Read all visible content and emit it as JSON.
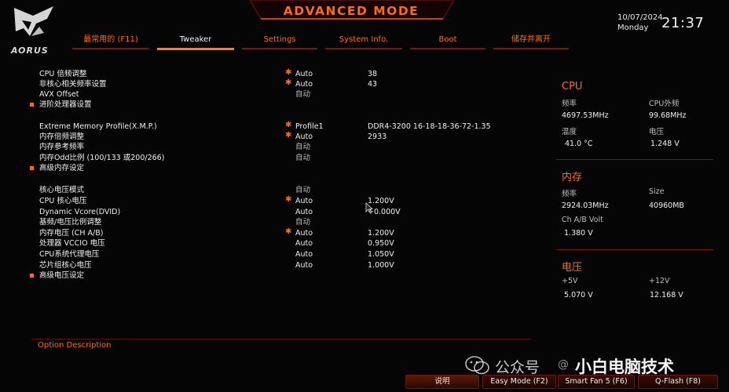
{
  "header": {
    "brand": "AORUS",
    "title": "ADVANCED MODE",
    "date": "10/07/2024",
    "day": "Monday",
    "time": "21:37"
  },
  "tabs": [
    {
      "label": "最常用的 (F11)",
      "active": false
    },
    {
      "label": "Tweaker",
      "active": true
    },
    {
      "label": "Settings",
      "active": false
    },
    {
      "label": "System Info.",
      "active": false
    },
    {
      "label": "Boot",
      "active": false
    },
    {
      "label": "储存并离开",
      "active": false
    }
  ],
  "settings": [
    {
      "label": "CPU 倍频调整",
      "starred": true,
      "mode": "Auto",
      "value": "38"
    },
    {
      "label": "非核心相关频率设置",
      "starred": true,
      "mode": "Auto",
      "value": "43"
    },
    {
      "label": "AVX Offset",
      "mode": "自动"
    },
    {
      "label": "进阶处理器设置",
      "submenu": true
    },
    {
      "label": "Extreme Memory Profile(X.M.P.)",
      "starred": true,
      "mode": "Profile1",
      "value": "DDR4-3200 16-18-18-36-72-1.35"
    },
    {
      "label": "内存倍频调整",
      "starred": true,
      "mode": "Auto",
      "value": "2933"
    },
    {
      "label": "内存参考频率",
      "mode": "自动"
    },
    {
      "label": "内存Odd比例 (100/133 或200/266)",
      "mode": "自动"
    },
    {
      "label": "高级内存设定",
      "submenu": true
    },
    {
      "label": "核心电压模式",
      "mode": "自动"
    },
    {
      "label": "CPU 核心电压",
      "starred": true,
      "mode": "Auto",
      "value": "1.200V"
    },
    {
      "label": "Dynamic Vcore(DVID)",
      "mode": "Auto",
      "value": "+0.000V"
    },
    {
      "label": "基频/电压比例调整",
      "mode": "自动"
    },
    {
      "label": "内存电压 (CH A/B)",
      "starred": true,
      "mode": "Auto",
      "value": "1.200V"
    },
    {
      "label": "处理器 VCCIO 电压",
      "mode": "Auto",
      "value": "0.950V"
    },
    {
      "label": "CPU系统代理电压",
      "mode": "Auto",
      "value": "1.050V"
    },
    {
      "label": "芯片组核心电压",
      "mode": "Auto",
      "value": "1.000V"
    },
    {
      "label": "高级电压设定",
      "submenu": true
    }
  ],
  "monitor": {
    "cpu": {
      "title": "CPU",
      "freq_label": "频率",
      "freq": "4697.53MHz",
      "bclk_label": "CPU外频",
      "bclk": "99.68MHz",
      "temp_label": "温度",
      "temp": "41.0 °C",
      "volt_label": "电压",
      "volt": "1.248 V"
    },
    "memory": {
      "title": "内存",
      "freq_label": "频率",
      "freq": "2924.03MHz",
      "size_label": "Size",
      "size": "40960MB",
      "volt_label": "Ch A/B Volt",
      "volt": "1.380 V"
    },
    "voltage": {
      "title": "电压",
      "p5_label": "+5V",
      "p5": "5.070 V",
      "p12_label": "+12V",
      "p12": "12.168 V"
    }
  },
  "option_description": "Option Description",
  "watermark": {
    "prefix": "公众号",
    "at": "@",
    "name": "小白电脑技术"
  },
  "footer": {
    "help": "说明",
    "easy_mode": "Easy Mode (F2)",
    "smart_fan": "Smart Fan 5 (F6)",
    "qflash": "Q-Flash (F8)"
  },
  "colors": {
    "accent": "#ff6a1a",
    "accent_dark": "#7a1608",
    "background": "#050505"
  }
}
